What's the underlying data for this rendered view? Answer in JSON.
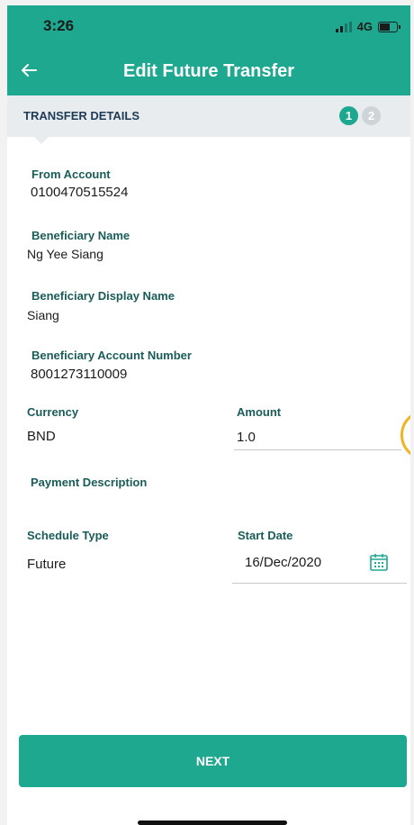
{
  "status": {
    "time": "3:26",
    "network": "4G"
  },
  "header": {
    "title": "Edit Future Transfer",
    "back_icon": "arrow-left-icon"
  },
  "steps": {
    "title": "TRANSFER DETAILS",
    "items": [
      {
        "label": "1",
        "state": "active"
      },
      {
        "label": "2",
        "state": "inactive"
      }
    ]
  },
  "form": {
    "from_account": {
      "label": "From Account",
      "value": "0100470515524"
    },
    "beneficiary_name": {
      "label": "Beneficiary Name",
      "value": "Ng Yee Siang"
    },
    "beneficiary_display_name": {
      "label": "Beneficiary Display Name",
      "value": "Siang"
    },
    "beneficiary_account_number": {
      "label": "Beneficiary Account Number",
      "value": "8001273110009"
    },
    "currency": {
      "label": "Currency",
      "value": "BND"
    },
    "amount": {
      "label": "Amount",
      "value": "1.0"
    },
    "payment_description": {
      "label": "Payment Description",
      "value": ""
    },
    "schedule_type": {
      "label": "Schedule Type",
      "value": "Future"
    },
    "start_date": {
      "label": "Start Date",
      "value": "16/Dec/2020",
      "icon": "calendar-icon"
    }
  },
  "actions": {
    "next_label": "NEXT"
  },
  "colors": {
    "primary": "#1ea88f",
    "label": "#1a5c58",
    "accent_ring": "#f0b323"
  }
}
